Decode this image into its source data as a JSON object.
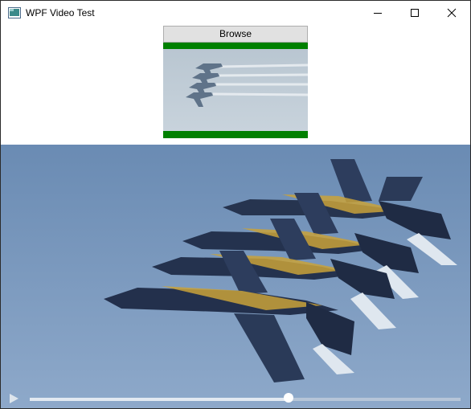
{
  "window": {
    "title": "WPF Video Test"
  },
  "caption": {
    "minimize": "minimize-icon",
    "maximize": "maximize-icon",
    "close": "close-icon"
  },
  "browse": {
    "label": "Browse"
  },
  "player": {
    "progress": 0.6,
    "play_icon": "play-icon"
  },
  "colors": {
    "preview_border": "#008000",
    "sky": "#7f9ec2",
    "jet_body": "#24324f",
    "jet_accent": "#c8a23a"
  }
}
